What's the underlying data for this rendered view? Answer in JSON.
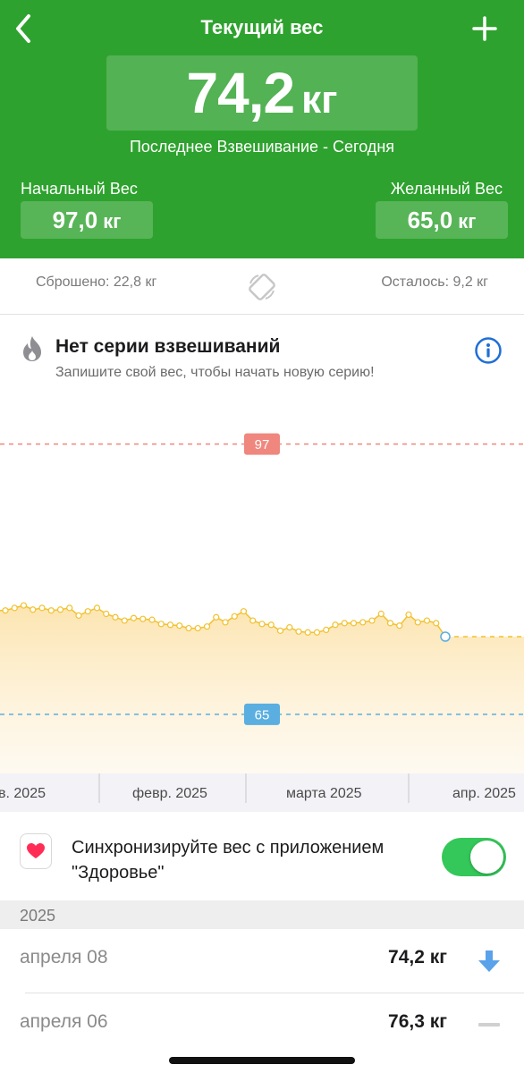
{
  "header": {
    "title": "Текущий вес",
    "current_weight": "74,2",
    "unit": "кг",
    "last_weigh": "Последнее Взвешивание - Сегодня",
    "start_label": "Начальный Вес",
    "start_value": "97,0",
    "goal_label": "Желанный Вес",
    "goal_value": "65,0"
  },
  "summary": {
    "lost": "Сброшено: 22,8 кг",
    "remaining": "Осталось: 9,2 кг"
  },
  "streak": {
    "title": "Нет серии взвешиваний",
    "subtitle": "Запишите свой вес, чтобы начать новую серию!"
  },
  "chart_data": {
    "type": "area",
    "start_line": "97",
    "goal_line": "65",
    "x_labels": [
      "в. 2025",
      "февр. 2025",
      "марта 2025",
      "апр. 2025"
    ],
    "ylim": [
      58,
      103
    ],
    "values": [
      77.3,
      77.6,
      77.9,
      77.4,
      77.6,
      77.3,
      77.4,
      77.6,
      76.7,
      77.2,
      77.6,
      76.9,
      76.5,
      76.1,
      76.4,
      76.3,
      76.2,
      75.7,
      75.6,
      75.5,
      75.2,
      75.2,
      75.4,
      76.5,
      75.9,
      76.6,
      77.2,
      76.1,
      75.7,
      75.6,
      74.9,
      75.3,
      74.8,
      74.7,
      74.7,
      75.0,
      75.6,
      75.8,
      75.8,
      75.9,
      76.1,
      76.9,
      75.8,
      75.5,
      76.8,
      75.9,
      76.1,
      75.8,
      74.2
    ],
    "colors": {
      "line": "#f2c12e",
      "fill": "#fde7b6",
      "start": "#f0877e",
      "goal": "#5aaee0",
      "last_point": "#5aaee0"
    }
  },
  "sync": {
    "text": "Синхронизируйте вес с приложением \"Здоровье\"",
    "enabled": true
  },
  "history": {
    "year": "2025",
    "entries": [
      {
        "date": "апреля 08",
        "weight": "74,2 кг",
        "trend": "down-arrow-icon"
      },
      {
        "date": "апреля 06",
        "weight": "76,3 кг",
        "trend": "minus-icon"
      }
    ]
  },
  "colors": {
    "header_bg": "#2ea22e",
    "accent_blue": "#1f6fd6",
    "toggle_on": "#34c759"
  }
}
